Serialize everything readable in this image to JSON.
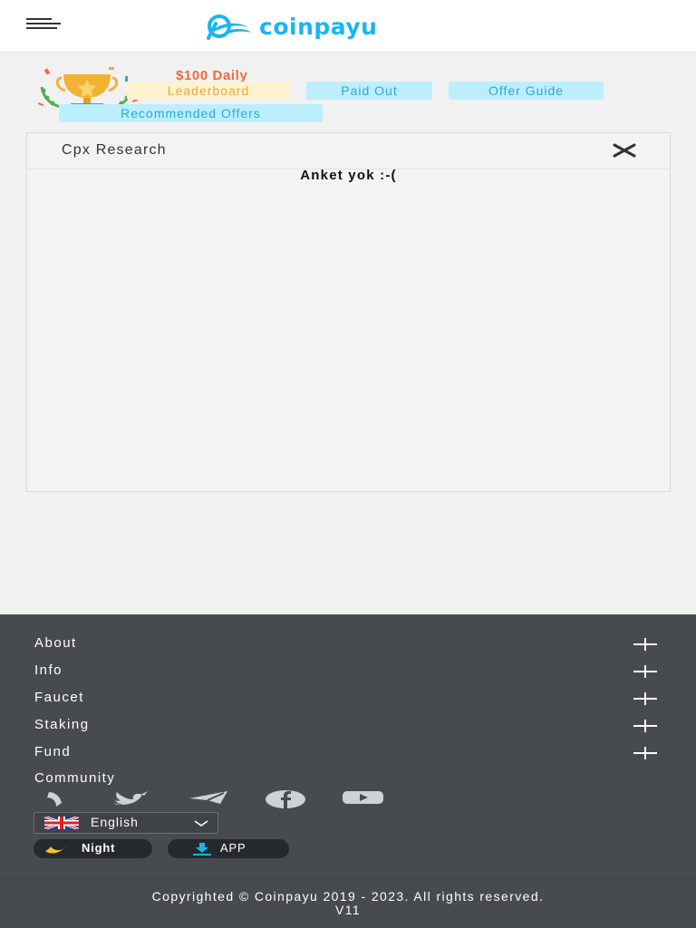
{
  "header": {
    "brand": "coinpayu",
    "menu_icon": "hamburger-icon",
    "brand_color": "#19b5ee"
  },
  "promo": {
    "daily_text": "$100 Daily",
    "links": {
      "leaderboard": "Leaderboard",
      "paid_out": "Paid Out",
      "offer_guide": "Offer Guide",
      "recommended": "Recommended Offers"
    },
    "trophy_icon": "trophy-icon"
  },
  "panel": {
    "title": "Cpx Research",
    "message": "Anket yok :-(",
    "close_icon": "close-icon"
  },
  "footer": {
    "sections": [
      "About",
      "Info",
      "Faucet",
      "Staking",
      "Fund"
    ],
    "community_label": "Community",
    "social_icons": [
      "medium-icon",
      "twitter-icon",
      "telegram-icon",
      "facebook-icon",
      "youtube-icon"
    ],
    "language": "English",
    "night_label": "Night",
    "app_label": "APP",
    "copyright": "Copyrighted © Coinpayu 2019 - 2023. All rights reserved.",
    "version": "V11",
    "background": "#474b4f"
  }
}
